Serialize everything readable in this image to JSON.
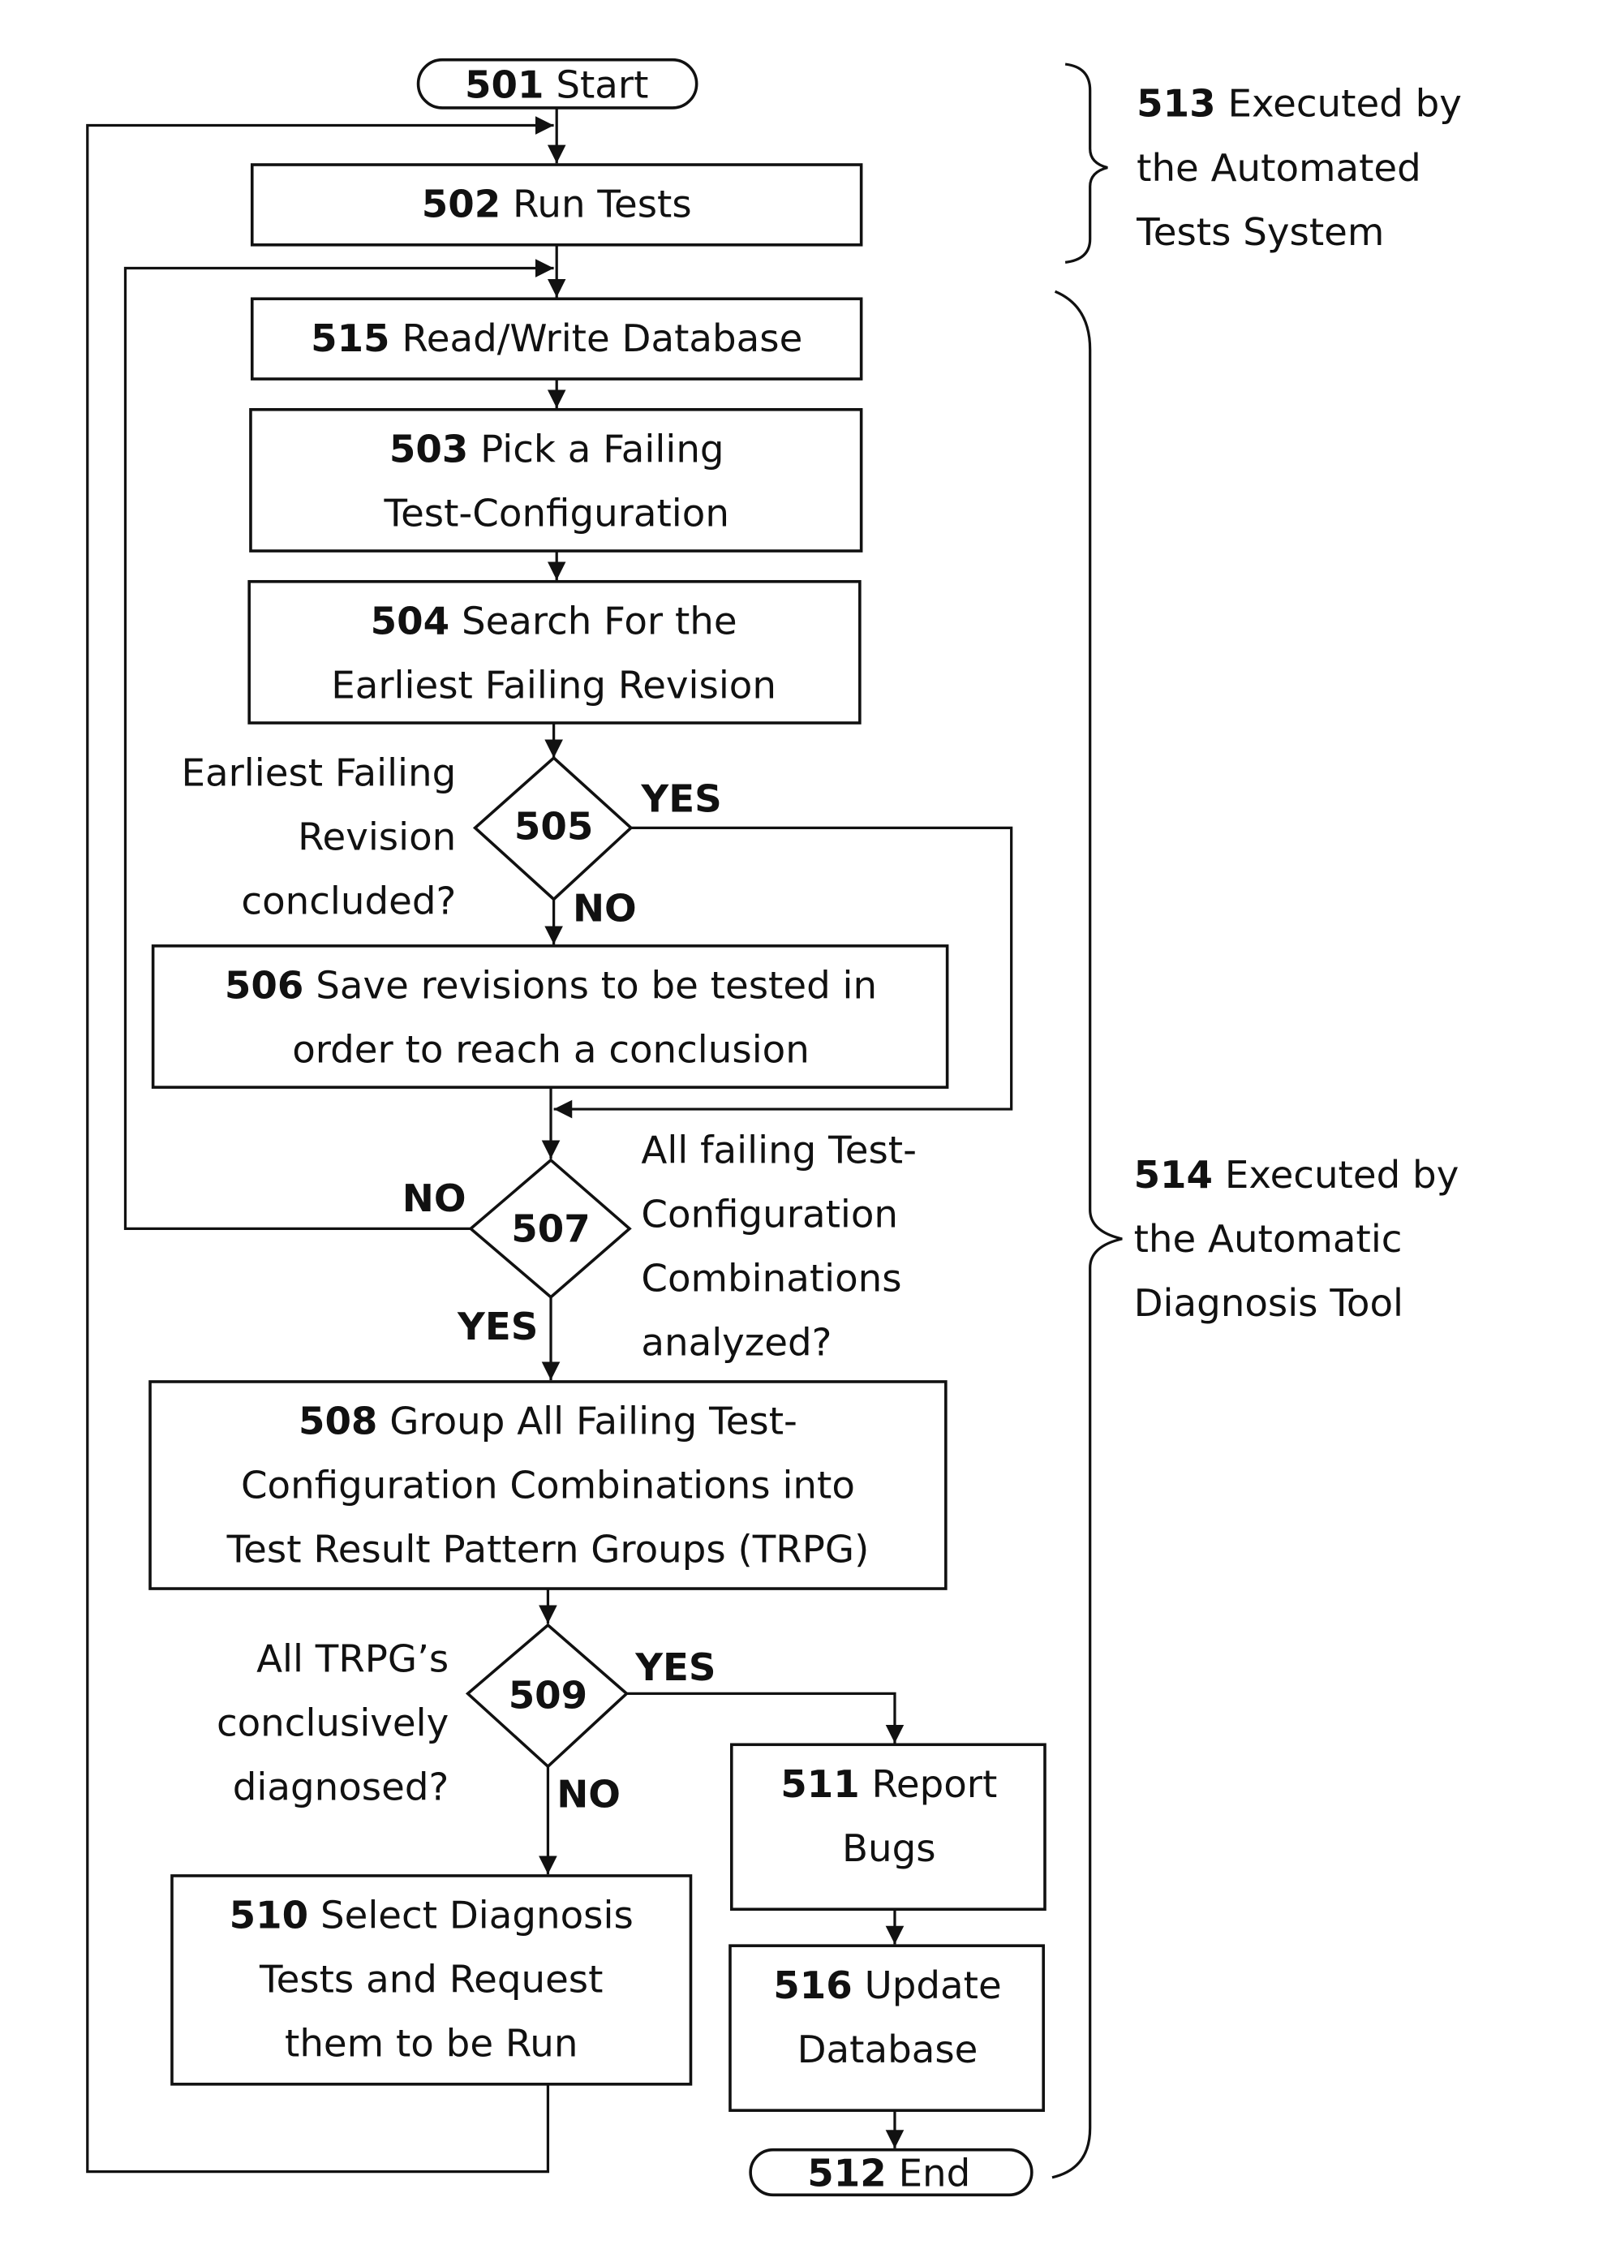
{
  "nodes": {
    "n501": {
      "id": "501",
      "text": "Start"
    },
    "n502": {
      "id": "502",
      "text": "Run Tests"
    },
    "n515": {
      "id": "515",
      "text": "Read/Write Database"
    },
    "n503": {
      "id": "503",
      "lines": [
        "Pick a Failing",
        "Test-Configuration"
      ]
    },
    "n504": {
      "id": "504",
      "lines": [
        "Search For the",
        "Earliest Failing Revision"
      ]
    },
    "n505": {
      "id": "505",
      "question": [
        "Earliest Failing",
        "Revision",
        "concluded?"
      ],
      "yes": "YES",
      "no": "NO"
    },
    "n506": {
      "id": "506",
      "lines": [
        "Save revisions to be tested in",
        "order to reach a conclusion"
      ]
    },
    "n507": {
      "id": "507",
      "question": [
        "All failing Test-",
        "Configuration",
        "Combinations",
        "analyzed?"
      ],
      "yes": "YES",
      "no": "NO"
    },
    "n508": {
      "id": "508",
      "lines": [
        "Group All Failing Test-",
        "Configuration Combinations into",
        "Test Result Pattern Groups (TRPG)"
      ]
    },
    "n509": {
      "id": "509",
      "question": [
        "All TRPG’s",
        "conclusively",
        "diagnosed?"
      ],
      "yes": "YES",
      "no": "NO"
    },
    "n510": {
      "id": "510",
      "lines": [
        "Select Diagnosis",
        "Tests and Request",
        "them to be Run"
      ]
    },
    "n511": {
      "id": "511",
      "lines": [
        "Report",
        "Bugs"
      ]
    },
    "n516": {
      "id": "516",
      "lines": [
        "Update",
        "Database"
      ]
    },
    "n512": {
      "id": "512",
      "text": "End"
    }
  },
  "braces": {
    "b513": {
      "id": "513",
      "lines": [
        "Executed by",
        "the Automated",
        "Tests System"
      ]
    },
    "b514": {
      "id": "514",
      "lines": [
        "Executed by",
        "the Automatic",
        "Diagnosis Tool"
      ]
    }
  }
}
